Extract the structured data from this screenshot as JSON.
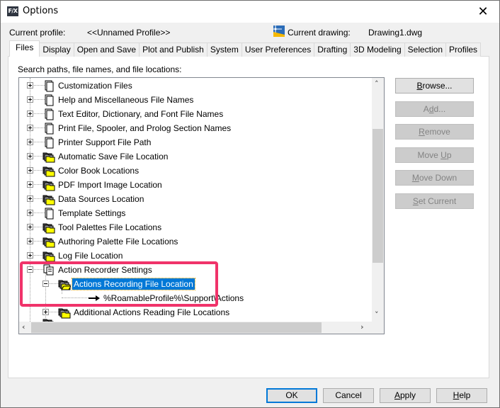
{
  "window": {
    "title": "Options",
    "logo_text": "F/X",
    "close_glyph": "✕"
  },
  "header": {
    "current_profile_label": "Current profile:",
    "current_profile_value": "<<Unnamed Profile>>",
    "current_drawing_label": "Current drawing:",
    "current_drawing_value": "Drawing1.dwg",
    "drawing_icon": "drawing-file-icon"
  },
  "tabs": [
    {
      "label": "Files",
      "active": true
    },
    {
      "label": "Display",
      "active": false
    },
    {
      "label": "Open and Save",
      "active": false
    },
    {
      "label": "Plot and Publish",
      "active": false
    },
    {
      "label": "System",
      "active": false
    },
    {
      "label": "User Preferences",
      "active": false
    },
    {
      "label": "Drafting",
      "active": false
    },
    {
      "label": "3D Modeling",
      "active": false
    },
    {
      "label": "Selection",
      "active": false
    },
    {
      "label": "Profiles",
      "active": false
    }
  ],
  "files_tab": {
    "section_label": "Search paths, file names, and file locations:",
    "tree": [
      {
        "label": "Customization Files",
        "icon": "file-stack-icon",
        "expanded": false,
        "level": 0
      },
      {
        "label": "Help and Miscellaneous File Names",
        "icon": "file-stack-icon",
        "expanded": false,
        "level": 0
      },
      {
        "label": "Text Editor, Dictionary, and Font File Names",
        "icon": "file-stack-icon",
        "expanded": false,
        "level": 0
      },
      {
        "label": "Print File, Spooler, and Prolog Section Names",
        "icon": "file-stack-icon",
        "expanded": false,
        "level": 0
      },
      {
        "label": "Printer Support File Path",
        "icon": "file-stack-icon",
        "expanded": false,
        "level": 0
      },
      {
        "label": "Automatic Save File Location",
        "icon": "folder-stack-icon",
        "expanded": false,
        "level": 0
      },
      {
        "label": "Color Book Locations",
        "icon": "folder-stack-icon",
        "expanded": false,
        "level": 0
      },
      {
        "label": "PDF Import Image Location",
        "icon": "folder-stack-icon",
        "expanded": false,
        "level": 0
      },
      {
        "label": "Data Sources Location",
        "icon": "folder-stack-icon",
        "expanded": false,
        "level": 0
      },
      {
        "label": "Template Settings",
        "icon": "file-stack-icon",
        "expanded": false,
        "level": 0
      },
      {
        "label": "Tool Palettes File Locations",
        "icon": "folder-stack-icon",
        "expanded": false,
        "level": 0
      },
      {
        "label": "Authoring Palette File Locations",
        "icon": "folder-stack-icon",
        "expanded": false,
        "level": 0
      },
      {
        "label": "Log File Location",
        "icon": "folder-stack-icon",
        "expanded": false,
        "level": 0
      },
      {
        "label": "Action Recorder Settings",
        "icon": "settings-doc-icon",
        "expanded": true,
        "level": 0
      },
      {
        "label": "Actions Recording File Location",
        "icon": "open-folder-icon",
        "expanded": true,
        "level": 1,
        "selected": true
      },
      {
        "label": "%RoamableProfile%\\Support\\Actions",
        "icon": "arrow-right-icon",
        "level": 2
      },
      {
        "label": "Additional Actions Reading File Locations",
        "icon": "folder-stack-icon",
        "expanded": false,
        "level": 1
      }
    ],
    "buttons": {
      "browse": {
        "pre": "",
        "mn": "B",
        "post": "rowse...",
        "enabled": true
      },
      "add": {
        "pre": "A",
        "mn": "d",
        "post": "d...",
        "enabled": false
      },
      "remove": {
        "pre": "",
        "mn": "R",
        "post": "emove",
        "enabled": false
      },
      "move_up": {
        "pre": "Move ",
        "mn": "U",
        "post": "p",
        "enabled": false
      },
      "move_down": {
        "pre": "",
        "mn": "M",
        "post": "ove Down",
        "enabled": false
      },
      "set_current": {
        "pre": "",
        "mn": "S",
        "post": "et Current",
        "enabled": false
      }
    }
  },
  "footer": {
    "ok": {
      "pre": "OK",
      "mn": "",
      "post": ""
    },
    "cancel": {
      "pre": "Cancel",
      "mn": "",
      "post": ""
    },
    "apply": {
      "pre": "",
      "mn": "A",
      "post": "pply"
    },
    "help": {
      "pre": "",
      "mn": "H",
      "post": "elp"
    }
  },
  "colors": {
    "selection": "#0078d7",
    "highlight_annotation": "#f0336a",
    "folder_yellow": "#ffff00"
  }
}
